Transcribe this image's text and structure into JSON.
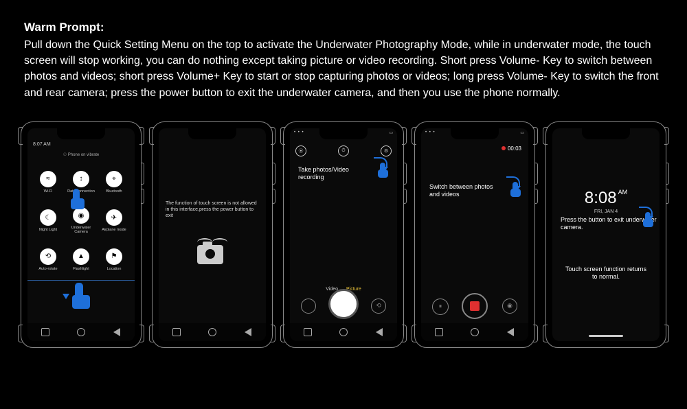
{
  "header": {
    "title": "Warm Prompt:",
    "body": "Pull down the Quick Setting Menu on the top to activate the Underwater Photography Mode, while in underwater mode, the touch screen will stop working, you can do nothing except taking picture or video recording. Short press Volume- Key to switch between photos and videos; short press Volume+ Key to start or stop capturing photos or videos; long press Volume- Key to switch the front and rear camera; press the power button to exit the underwater camera, and then you use the phone normally."
  },
  "phone1": {
    "time": "8:07 AM",
    "status": "Phone on vibrate",
    "tiles": [
      {
        "label": "Wi-Fi",
        "glyph": "≈"
      },
      {
        "label": "Data connection",
        "glyph": "↕"
      },
      {
        "label": "Bluetooth",
        "glyph": "⌖"
      },
      {
        "label": "Night Light",
        "glyph": "☾"
      },
      {
        "label": "Underwater Camera",
        "glyph": "◉"
      },
      {
        "label": "Airplane mode",
        "glyph": "✈"
      },
      {
        "label": "Auto-rotate",
        "glyph": "⟲"
      },
      {
        "label": "Flashlight",
        "glyph": "▲"
      },
      {
        "label": "Location",
        "glyph": "⚑"
      }
    ]
  },
  "phone2": {
    "message": "The function of touch screen is not allowed in this interface,press the power button to exit"
  },
  "phone3": {
    "caption": "Take photos/Video recording",
    "modes": {
      "video": "Video",
      "picture": "Picture"
    },
    "status_left": "• • •",
    "status_right": "▭"
  },
  "phone4": {
    "caption": "Switch between photos and videos",
    "rec_time": "00:03",
    "status_left": "• • •",
    "status_right": "▭"
  },
  "phone5": {
    "time": "8:08",
    "ampm": "AM",
    "date": "FRI, JAN 4",
    "caption1": "Press the  button to exit underwater camera.",
    "caption2": "Touch screen function returns to normal."
  }
}
